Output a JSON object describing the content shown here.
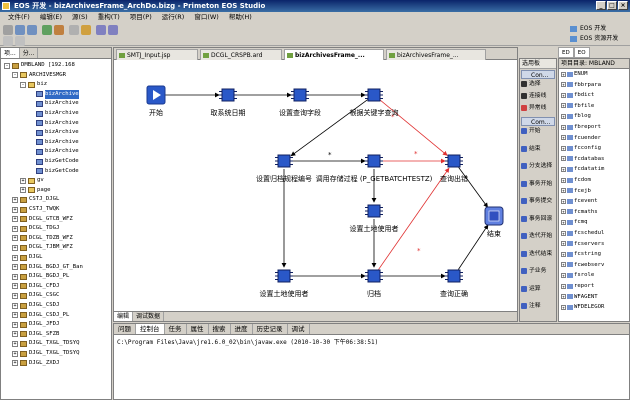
{
  "window": {
    "title": "EOS 开发 - bizArchivesFrame_ArchDo.bizg - Primeton EOS Studio"
  },
  "menu": [
    "文件(F)",
    "编辑(E)",
    "源(S)",
    "重构(T)",
    "项目(P)",
    "运行(R)",
    "窗口(W)",
    "帮助(H)"
  ],
  "perspectives": [
    "EOS 开发",
    "EOS 资源开发"
  ],
  "navigator": {
    "tabs": [
      "项...",
      "分..."
    ],
    "rows": [
      {
        "t": "-",
        "icon": "folder",
        "label": "DMBLAND [192.168",
        "indent": 0
      },
      {
        "t": "-",
        "icon": "pkg",
        "label": "ARCHIVESMGR",
        "indent": 1
      },
      {
        "t": "-",
        "icon": "pkg",
        "label": "biz",
        "indent": 2
      },
      {
        "t": "",
        "icon": "file",
        "label": "bizArchive",
        "indent": 3,
        "sel": true
      },
      {
        "t": "",
        "icon": "file",
        "label": "bizArchive",
        "indent": 3
      },
      {
        "t": "",
        "icon": "file",
        "label": "bizArchive",
        "indent": 3
      },
      {
        "t": "",
        "icon": "file",
        "label": "bizArchive",
        "indent": 3
      },
      {
        "t": "",
        "icon": "file",
        "label": "bizArchive",
        "indent": 3
      },
      {
        "t": "",
        "icon": "file",
        "label": "bizArchive",
        "indent": 3
      },
      {
        "t": "",
        "icon": "file",
        "label": "bizArchive",
        "indent": 3
      },
      {
        "t": "",
        "icon": "file",
        "label": "bizGetCode",
        "indent": 3
      },
      {
        "t": "",
        "icon": "file",
        "label": "bizGetCode",
        "indent": 3
      },
      {
        "t": "+",
        "icon": "pkg",
        "label": "gv",
        "indent": 2
      },
      {
        "t": "+",
        "icon": "pkg",
        "label": "page",
        "indent": 2
      },
      {
        "t": "+",
        "icon": "folder",
        "label": "CSTJ_DJGL",
        "indent": 1
      },
      {
        "t": "+",
        "icon": "folder",
        "label": "CSTJ_TWQK",
        "indent": 1
      },
      {
        "t": "+",
        "icon": "folder",
        "label": "DCGL_GTCB_WFZ",
        "indent": 1
      },
      {
        "t": "+",
        "icon": "folder",
        "label": "DCGL_TDGJ",
        "indent": 1
      },
      {
        "t": "+",
        "icon": "folder",
        "label": "DCGL_TDZB_WFZ",
        "indent": 1
      },
      {
        "t": "+",
        "icon": "folder",
        "label": "DCGL_TJBM_WFZ",
        "indent": 1
      },
      {
        "t": "+",
        "icon": "folder",
        "label": "DJGL",
        "indent": 1
      },
      {
        "t": "+",
        "icon": "folder",
        "label": "DJGL_BGDJ_GT_Ban",
        "indent": 1
      },
      {
        "t": "+",
        "icon": "folder",
        "label": "DJGL_BGDJ_PL",
        "indent": 1
      },
      {
        "t": "+",
        "icon": "folder",
        "label": "DJGL_CFDJ",
        "indent": 1
      },
      {
        "t": "+",
        "icon": "folder",
        "label": "DJGL_CSGC",
        "indent": 1
      },
      {
        "t": "+",
        "icon": "folder",
        "label": "DJGL_CSDJ",
        "indent": 1
      },
      {
        "t": "+",
        "icon": "folder",
        "label": "DJGL_CSDJ_PL",
        "indent": 1
      },
      {
        "t": "+",
        "icon": "folder",
        "label": "DJGL_JFDJ",
        "indent": 1
      },
      {
        "t": "+",
        "icon": "folder",
        "label": "DJGL_SFZB",
        "indent": 1
      },
      {
        "t": "+",
        "icon": "folder",
        "label": "DJGL_TXGL_TDSYQ",
        "indent": 1
      },
      {
        "t": "+",
        "icon": "folder",
        "label": "DJGL_TXGL_TDSYQ",
        "indent": 1
      },
      {
        "t": "+",
        "icon": "folder",
        "label": "DJGL_ZXDJ",
        "indent": 1
      }
    ]
  },
  "editor": {
    "tabs": [
      {
        "label": "SMTJ_Input.jsp",
        "active": false
      },
      {
        "label": "DCGL_CRSPB.ard",
        "active": false
      },
      {
        "label": "bizArchivesFrame_...",
        "active": true
      },
      {
        "label": "bizArchivesFrame_...",
        "active": false
      }
    ],
    "bottom_tabs": [
      "编辑",
      "调试数据"
    ]
  },
  "flow": {
    "nodes": [
      {
        "id": "start",
        "label": "开始",
        "type": "start"
      },
      {
        "id": "n1",
        "label": "取系统日期",
        "type": "step"
      },
      {
        "id": "n2",
        "label": "设置查询字段",
        "type": "step"
      },
      {
        "id": "n3",
        "label": "根据关键字查询",
        "type": "step"
      },
      {
        "id": "n4",
        "label": "设置归档规程编号",
        "type": "step"
      },
      {
        "id": "n5",
        "label": "调用存储过程 (P_GETBATCHTESTZ)",
        "type": "step"
      },
      {
        "id": "n6",
        "label": "查询出错",
        "type": "step"
      },
      {
        "id": "n7",
        "label": "设置土地使用者",
        "type": "step"
      },
      {
        "id": "end",
        "label": "结束",
        "type": "end"
      },
      {
        "id": "n8",
        "label": "设置土地使用者",
        "type": "step"
      },
      {
        "id": "n9",
        "label": "归档",
        "type": "step"
      },
      {
        "id": "n10",
        "label": "查询正确",
        "type": "step"
      }
    ],
    "edge_marks": [
      "*",
      "*",
      "*",
      "*"
    ]
  },
  "palette": {
    "title": "选用板",
    "sections": [
      "Con...",
      "Com..."
    ],
    "items_top": [
      {
        "label": "选择",
        "color": "#303030"
      },
      {
        "label": "连接线",
        "color": "#303030"
      },
      {
        "label": "异常线",
        "color": "#d04040"
      }
    ],
    "items_bottom": [
      {
        "label": "开始",
        "color": "#4060c0"
      },
      {
        "label": "结束",
        "color": "#4060c0"
      },
      {
        "label": "分支选择",
        "color": "#4060c0"
      },
      {
        "label": "事务开始",
        "color": "#4060c0"
      },
      {
        "label": "事务提交",
        "color": "#4060c0"
      },
      {
        "label": "事务回滚",
        "color": "#4060c0"
      },
      {
        "label": "迭代开始",
        "color": "#4060c0"
      },
      {
        "label": "迭代结束",
        "color": "#4060c0"
      },
      {
        "label": "子业务",
        "color": "#4060c0"
      },
      {
        "label": "运算",
        "color": "#4060c0"
      },
      {
        "label": "注释",
        "color": "#4060c0"
      }
    ]
  },
  "project": {
    "tabs": [
      "ED",
      "EO"
    ],
    "title": "项目目录: MBLAND",
    "rows": [
      "ENUM",
      "fbbrpara",
      "fbdict",
      "fbfile",
      "fblog",
      "fbreport",
      "fcuender",
      "fcconfig",
      "fcdatabas",
      "fcdatatim",
      "fcdom",
      "fcejb",
      "fcevent",
      "fcmaths",
      "fcmq",
      "fcschedul",
      "fcservers",
      "fcstring",
      "fcwebserv",
      "fsrole",
      "report",
      "WFAGENT",
      "WFDELEGOR"
    ]
  },
  "console": {
    "tabs": [
      "问题",
      "控制台",
      "任务",
      "属性",
      "搜索",
      "进度",
      "历史记录",
      "调试"
    ],
    "active_tab": "控制台",
    "line": "C:\\Program Files\\Java\\jre1.6.0_02\\bin\\javaw.exe (2010-10-30 下午06:38:51)"
  },
  "colors": {
    "accent_titlebar": "#0a246a",
    "node_blue": "#2a58c8",
    "exception_red": "#e03030"
  }
}
